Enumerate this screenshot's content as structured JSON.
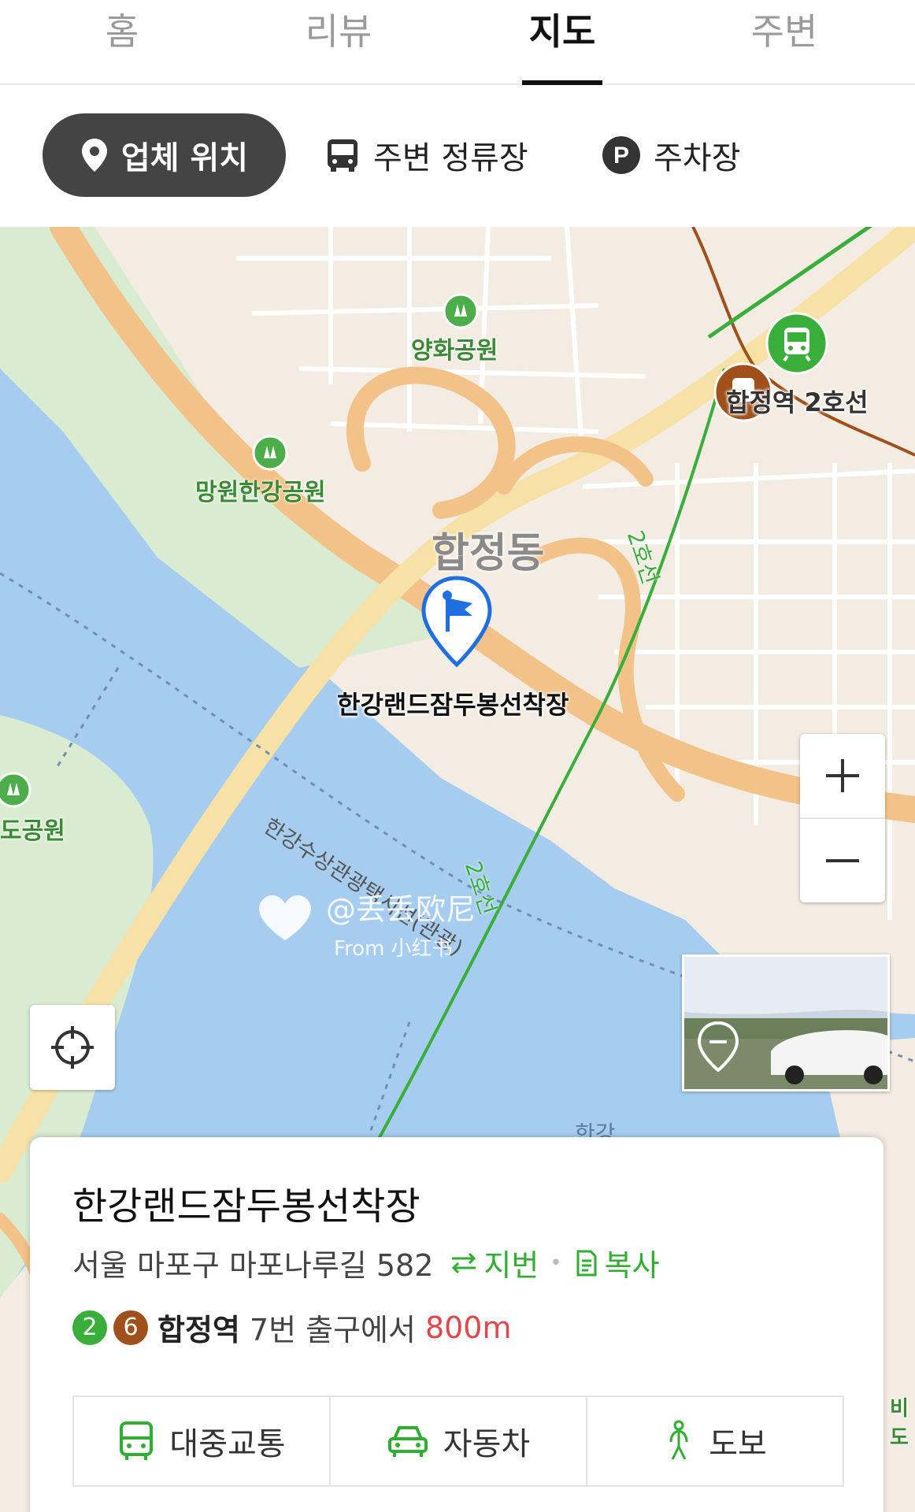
{
  "tabs": [
    {
      "label": "홈"
    },
    {
      "label": "리뷰"
    },
    {
      "label": "지도",
      "active": true
    },
    {
      "label": "주변"
    }
  ],
  "filters": [
    {
      "label": "업체 위치",
      "active": true,
      "icon": "pin-icon"
    },
    {
      "label": "주변 정류장",
      "icon": "bus-icon"
    },
    {
      "label": "주차장",
      "icon": "parking-icon"
    }
  ],
  "map": {
    "labels": {
      "yanghwa_park": "양화공원",
      "mangwon_park": "망원한강공원",
      "hapjeong_dong": "합정동",
      "station": "합정역 2호선",
      "line2_a": "2호선",
      "line2_b": "2호선",
      "place": "한강랜드잠두봉선착장",
      "ferry_route": "한강수상관광택시선(관광)",
      "river": "한강",
      "seonyudo_park": "도공원",
      "right_edge": "비도"
    },
    "watermark": {
      "handle": "@丢丢欧尼",
      "source": "From 小红书"
    }
  },
  "card": {
    "title": "한강랜드잠두봉선착장",
    "address": "서울 마포구 마포나루길 582",
    "jibun_label": "지번",
    "copy_label": "복사",
    "line_badges": [
      {
        "num": "2",
        "color": "#3aae3a"
      },
      {
        "num": "6",
        "color": "#a0501a"
      }
    ],
    "station": "합정역",
    "exit_text": "7번 출구에서",
    "distance": "800m",
    "distance_color": "#e0474c",
    "buttons": [
      {
        "label": "대중교통",
        "icon": "bus-icon"
      },
      {
        "label": "자동차",
        "icon": "car-icon"
      },
      {
        "label": "도보",
        "icon": "walk-icon"
      }
    ]
  }
}
